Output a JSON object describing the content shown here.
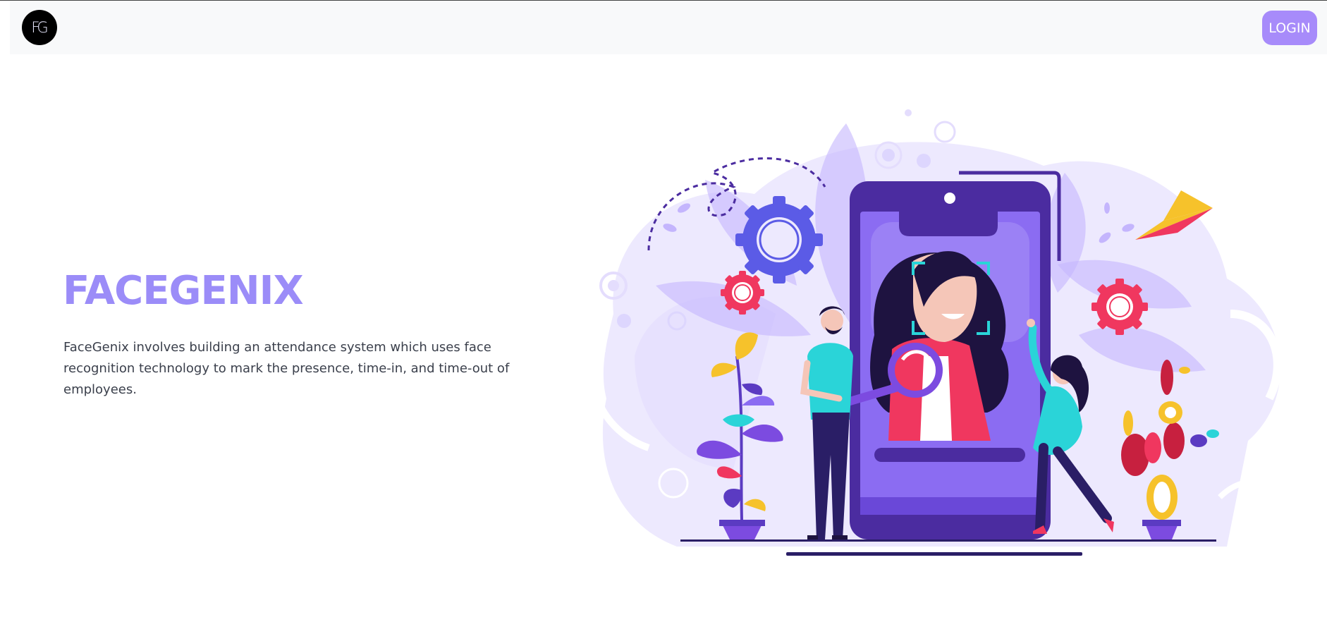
{
  "navbar": {
    "logo_text": "FG",
    "login_label": "LOGIN",
    "icons": {
      "logo": "logo-icon"
    }
  },
  "hero": {
    "title": "FACEGENIX",
    "description": "FaceGenix involves building an attendance system which uses face recognition technology to mark the presence, time-in, and time-out of employees."
  },
  "colors": {
    "accent": "#a78bfa",
    "title": "#9b8cf8",
    "phone": "#4b2ca0",
    "screen": "#8b6cf2",
    "gear_blue": "#5b5be6",
    "gear_red": "#f0375f",
    "teal": "#2ad4d8",
    "navbar_bg": "#f8f9fa"
  }
}
